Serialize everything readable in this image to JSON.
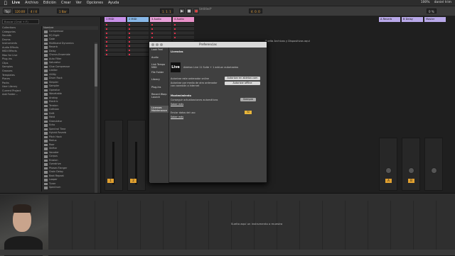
{
  "menubar": {
    "app": "Live",
    "items": [
      "Archivo",
      "Edición",
      "Crear",
      "Ver",
      "Opciones",
      "Ayuda"
    ],
    "right": [
      "100%",
      "daniel trim"
    ]
  },
  "transport": {
    "tap": "Tap",
    "tempo": "120.00",
    "sig": "4 / 4",
    "metro": "1 Bar",
    "pos": "1. 1. 1",
    "loop": "4. 0. 0",
    "cpu": "0 %",
    "project_title": "Untitled*"
  },
  "browser": {
    "search_placeholder": "Buscar (Cmd + F)",
    "places": [
      "Collections",
      "Categories",
      "Sounds",
      "Drums",
      "Instruments",
      "Audio Effects",
      "MIDI Effects",
      "Max for Live",
      "Plug-ins",
      "Clips",
      "Samples",
      "Grooves",
      "Templates",
      "Places",
      "Packs",
      "User Library",
      "Current Project",
      "Add Folder…"
    ],
    "files_header": "Nombre",
    "files": [
      "Compressor",
      "EQ Eight",
      "Gate",
      "Multiband Dynamics",
      "Reverb",
      "Delay",
      "Chorus-Ensemble",
      "Auto Filter",
      "Saturator",
      "Glue Compressor",
      "Limiter",
      "Utility",
      "Drum Rack",
      "Simpler",
      "Sampler",
      "Operator",
      "Wavetable",
      "Analog",
      "Electric",
      "Tension",
      "Collision",
      "Drift",
      "Meld",
      "Granulator",
      "Echo",
      "Spectral Time",
      "Hybrid Reverb",
      "Pitch Hack",
      "Redux",
      "Roar",
      "Shifter",
      "Vocoder",
      "Corpus",
      "Erosion",
      "Overdrive",
      "Phaser-Flanger",
      "Grain Delay",
      "Beat Repeat",
      "Looper",
      "Tuner",
      "Spectrum"
    ]
  },
  "session": {
    "tracks": [
      {
        "name": "1 MIDI",
        "color": "#c890e8"
      },
      {
        "name": "2 MIDI",
        "color": "#88b8e8"
      },
      {
        "name": "3 Audio",
        "color": "#e8a0d8"
      },
      {
        "name": "4 Audio",
        "color": "#e890c8"
      }
    ],
    "returns": [
      {
        "name": "A Reverb",
        "color": "#b8a8e8"
      },
      {
        "name": "B Delay",
        "color": "#b8a8e8"
      }
    ],
    "master": {
      "name": "Master",
      "color": "#b8a8e8"
    },
    "drop_text": "Suelta Archivos y Dispositivos aquí",
    "track_numbers": [
      "1",
      "2"
    ],
    "return_letters": [
      "A",
      "B"
    ]
  },
  "prefs": {
    "title": "Preferencias",
    "tabs": [
      "Look Feel",
      "Audio",
      "Link Tempo MIDI",
      "File Folder",
      "Library",
      "Plug-Ins",
      "Record Warp Launch",
      "Licenses Maintenance"
    ],
    "active_tab": 7,
    "heading_licenses": "Licencias",
    "logo": "Live",
    "license_line": "Ableton Live 11 Suite + 1 add-on autorizados",
    "authorize_online": "Autorizar este ordenador online",
    "authorize_online_btn": "Autorizar en ableton.com",
    "authorize_offline": "Autorizar por medio de otro ordenador con conexión a Internet",
    "authorize_offline_btn": "Autorizar offline",
    "heading_maintenance": "Mantenimiento",
    "updates_label": "Conseguir actualizaciones automáticas",
    "updates_value": "Siempre",
    "learn_more": "Saber más",
    "send_usage": "Enviar datos del uso",
    "send_usage_value": "Sí",
    "learn_more2": "Saber más"
  },
  "clip_area": {
    "drop_text": "Suelta aquí un instrumento o muestra"
  }
}
